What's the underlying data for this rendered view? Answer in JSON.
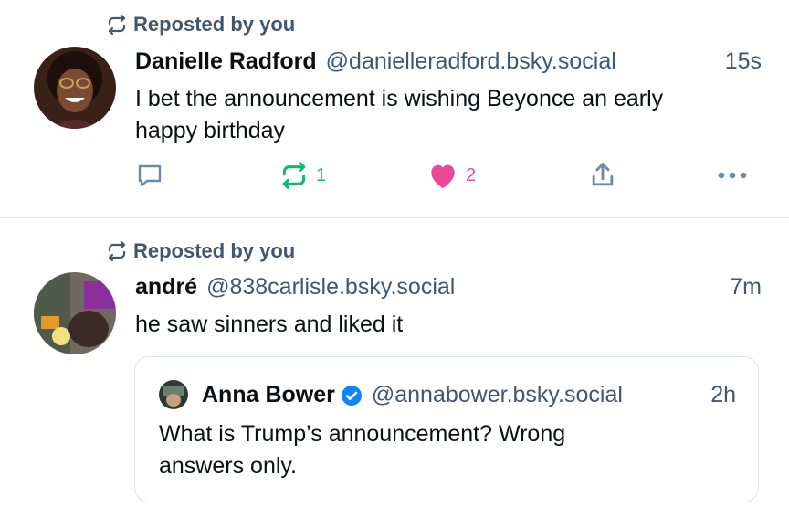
{
  "colors": {
    "accent_repost": "#13b96b",
    "like_pink": "#ec4899",
    "secondary_text": "#42576c",
    "action_blue_gray": "#6b8aa8",
    "verified_blue": "#1083fe"
  },
  "posts": [
    {
      "repost_label": "Reposted by you",
      "author_name": "Danielle Radford",
      "author_handle": "@danielleradford.bsky.social",
      "timestamp": "15s",
      "text_line1": "I bet the announcement is wishing Beyonce an early",
      "text_line2": "happy birthday",
      "reply_count": "",
      "repost_count": "1",
      "like_count": "2"
    },
    {
      "repost_label": "Reposted by you",
      "author_name": "andré",
      "author_handle": "@838carlisle.bsky.social",
      "timestamp": "7m",
      "text": "he saw sinners and liked it",
      "quote": {
        "author_name": "Anna Bower",
        "author_handle": "@annabower.bsky.social",
        "timestamp": "2h",
        "verified": true,
        "text_line1": "What is Trump’s announcement? Wrong",
        "text_line2": "answers only."
      }
    }
  ],
  "icons": {
    "repost": "repost-icon",
    "reply": "reply-icon",
    "like": "heart-icon",
    "share": "share-icon",
    "more": "more-icon",
    "verified": "verified-badge-icon"
  }
}
